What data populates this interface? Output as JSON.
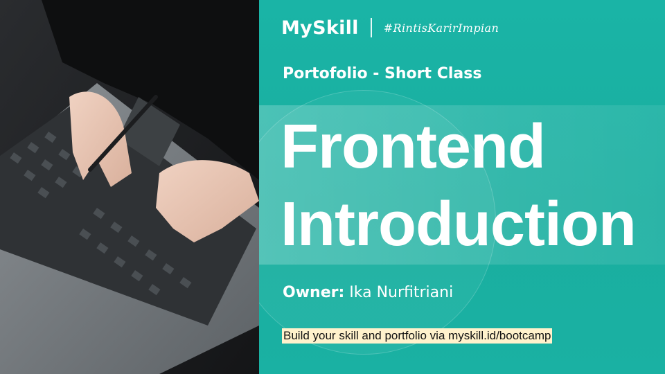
{
  "photo": {
    "alt_icon": "laptop-typing-photo"
  },
  "header": {
    "brand": "MySkill",
    "tagline": "#RintisKarirImpian"
  },
  "slide": {
    "subtitle": "Portofolio - Short Class",
    "title_line1": "Frontend",
    "title_line2": "Introduction",
    "owner_label": "Owner:",
    "owner_name": "Ika Nurfitriani",
    "promo": "Build your skill and portfolio via myskill.id/bootcamp"
  },
  "colors": {
    "teal": "#1bb3a6",
    "highlight": "#fff2cc",
    "text": "#ffffff"
  }
}
